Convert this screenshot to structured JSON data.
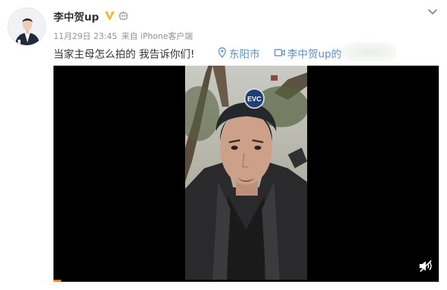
{
  "post": {
    "author": {
      "name": "李中贺up",
      "avatar_icon": "user-avatar",
      "badges": [
        "vip-verified-icon",
        "robot-icon"
      ],
      "badge_color": "#f6b72c"
    },
    "menu_icon": "chevron-down-icon",
    "meta": {
      "timestamp": "11月29日 23:45",
      "source": "来自 iPhone客户端"
    },
    "text": "当家主母怎么拍的 我告诉你们!",
    "location": {
      "icon": "location-pin-icon",
      "label": "东阳市"
    },
    "video_link": {
      "icon": "video-icon",
      "label": "李中贺up的"
    },
    "link_color": "#5c8ecd",
    "video": {
      "mute_icon": "sound-muted-icon",
      "progress": 0.02,
      "progress_color": "#ff8200"
    }
  }
}
